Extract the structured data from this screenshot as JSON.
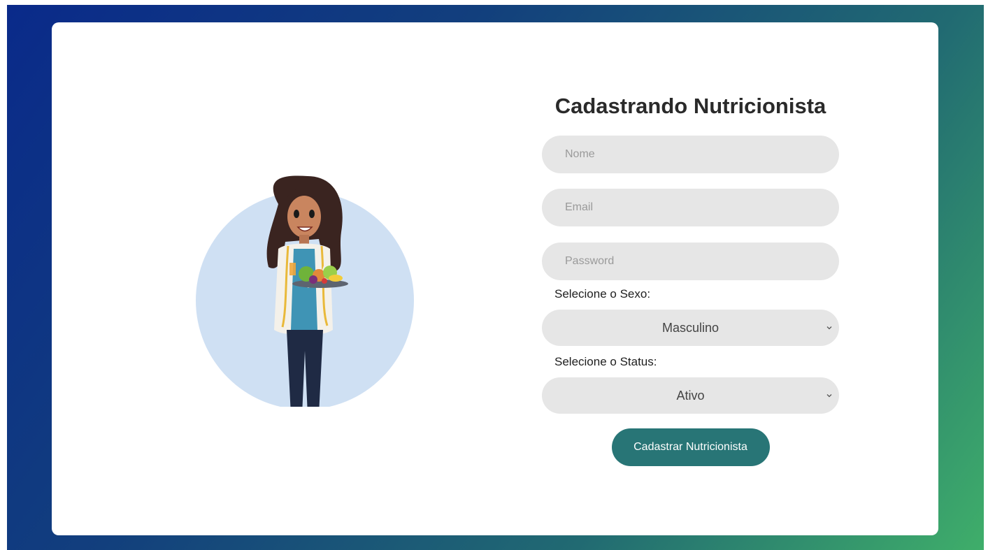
{
  "form": {
    "title": "Cadastrando Nutricionista",
    "name_placeholder": "Nome",
    "email_placeholder": "Email",
    "password_placeholder": "Password",
    "sex_label": "Selecione o Sexo:",
    "sex_selected": "Masculino",
    "status_label": "Selecione o Status:",
    "status_selected": "Ativo",
    "submit_label": "Cadastrar Nutricionista"
  },
  "colors": {
    "accent": "#287576",
    "field_bg": "#e6e6e6",
    "illustration_circle": "#cfe0f3"
  }
}
